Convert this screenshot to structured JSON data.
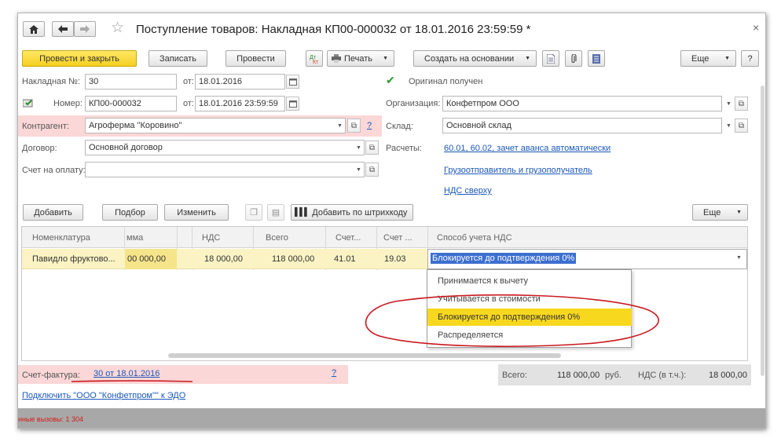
{
  "title": "Поступление товаров: Накладная КП00-000032 от 18.01.2016 23:59:59 *",
  "close": "×",
  "toolbar": {
    "post_close": "Провести и закрыть",
    "save": "Записать",
    "post": "Провести",
    "print": "Печать",
    "create_based": "Создать на основании",
    "more": "Еще",
    "help": "?"
  },
  "form": {
    "invoice_label": "Накладная №:",
    "invoice_value": "30",
    "from_label": "от:",
    "invoice_date": "18.01.2016",
    "original_label": "Оригинал получен",
    "number_label": "Номер:",
    "number_value": "КП00-000032",
    "number_date": "18.01.2016 23:59:59",
    "org_label": "Организация:",
    "org_value": "Конфетпром ООО",
    "contractor_label": "Контрагент:",
    "contractor_value": "Агроферма \"Коровино\"",
    "warehouse_label": "Склад:",
    "warehouse_value": "Основной склад",
    "contract_label": "Договор:",
    "contract_value": "Основной договор",
    "settlements_label": "Расчеты:",
    "settlements_link": "60.01, 60.02, зачет аванса автоматически",
    "payment_label": "Счет на оплату:",
    "payment_value": "",
    "shipper_link": "Грузоотправитель и грузополучатель",
    "vat_link": "НДС сверху",
    "help_mark": "?"
  },
  "table_toolbar": {
    "add": "Добавить",
    "select": "Подбор",
    "change": "Изменить",
    "barcode": "Добавить по штрихкоду",
    "more": "Еще"
  },
  "grid": {
    "headers": [
      "Номенклатура",
      "мма",
      "НДС",
      "Всего",
      "Счет...",
      "Счет ...",
      "Способ учета НДС"
    ],
    "row": [
      "Павидло фруктово...",
      "00 000,00",
      "18 000,00",
      "118 000,00",
      "41.01",
      "19.03",
      "Блокируется до подтверждения 0%"
    ]
  },
  "dropdown": {
    "items": [
      "Принимается к вычету",
      "Учитывается в стоимости",
      "Блокируется до подтверждения 0%",
      "Распределяется"
    ],
    "selected_index": 2
  },
  "footer": {
    "invoice_label": "Счет-фактура:",
    "invoice_link": "30 от 18.01.2016",
    "help_mark": "?",
    "total_label": "Всего:",
    "total_value": "118 000,00",
    "currency": "руб.",
    "vat_label": "НДС (в т.ч.):",
    "vat_value": "18 000,00",
    "edo_link": "Подключить \"ООО \"Конфетпром\"\" к ЭДО",
    "status_text": "нные вызовы: 1 304"
  },
  "colors": {
    "accent_yellow": "#f5cf20",
    "highlight_pink": "#fbd7d7",
    "selection_blue": "#3c6fcf",
    "annotation_red": "#c8181e",
    "link_blue": "#1b58b8"
  }
}
